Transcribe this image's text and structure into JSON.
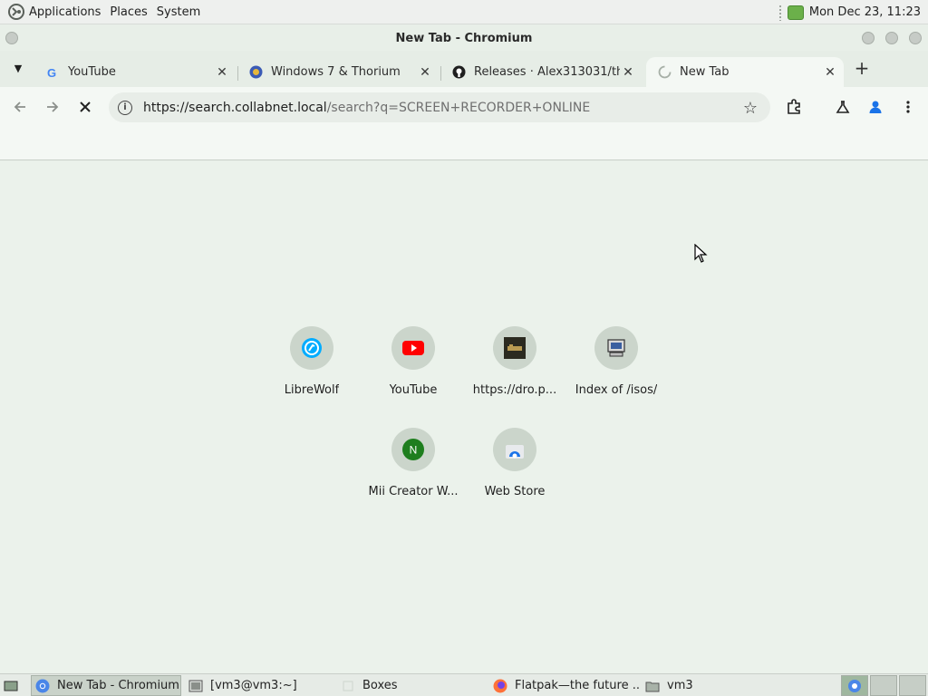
{
  "top_panel": {
    "menus": [
      "Applications",
      "Places",
      "System"
    ],
    "clock": "Mon Dec 23, 11:23"
  },
  "window": {
    "title": "New Tab - Chromium"
  },
  "tabs": [
    {
      "title": "YouTube",
      "icon": "google-icon"
    },
    {
      "title": "Windows 7 & Thorium",
      "icon": "thorium-icon"
    },
    {
      "title": "Releases · Alex313031/tho",
      "icon": "github-icon"
    },
    {
      "title": "New Tab",
      "icon": "loading-spinner-icon"
    }
  ],
  "toolbar": {
    "url_host": "https://search.collabnet.local",
    "url_path": "/search?q=SCREEN+RECORDER+ONLINE"
  },
  "shortcuts": [
    {
      "label": "LibreWolf",
      "icon": "librewolf-icon"
    },
    {
      "label": "YouTube",
      "icon": "youtube-icon"
    },
    {
      "label": "https://dro.p...",
      "icon": "site-thumbnail-icon"
    },
    {
      "label": "Index of /isos/",
      "icon": "computer-icon"
    },
    {
      "label": "Mii Creator W...",
      "icon": "letter-n-icon",
      "letter": "N"
    },
    {
      "label": "Web Store",
      "icon": "web-store-icon"
    }
  ],
  "taskbar": [
    {
      "label": "New Tab - Chromium",
      "icon": "chromium-icon",
      "active": true
    },
    {
      "label": "[vm3@vm3:~]",
      "icon": "terminal-icon",
      "active": false
    },
    {
      "label": "Boxes",
      "icon": "boxes-icon",
      "active": false
    },
    {
      "label": "Flatpak—the future ...",
      "icon": "firefox-icon",
      "active": false
    },
    {
      "label": "vm3",
      "icon": "folder-icon",
      "active": false
    }
  ],
  "colors": {
    "accent_blue": "#1a73e8",
    "youtube_red": "#ff0000",
    "panel_green": "#6bb04a"
  }
}
